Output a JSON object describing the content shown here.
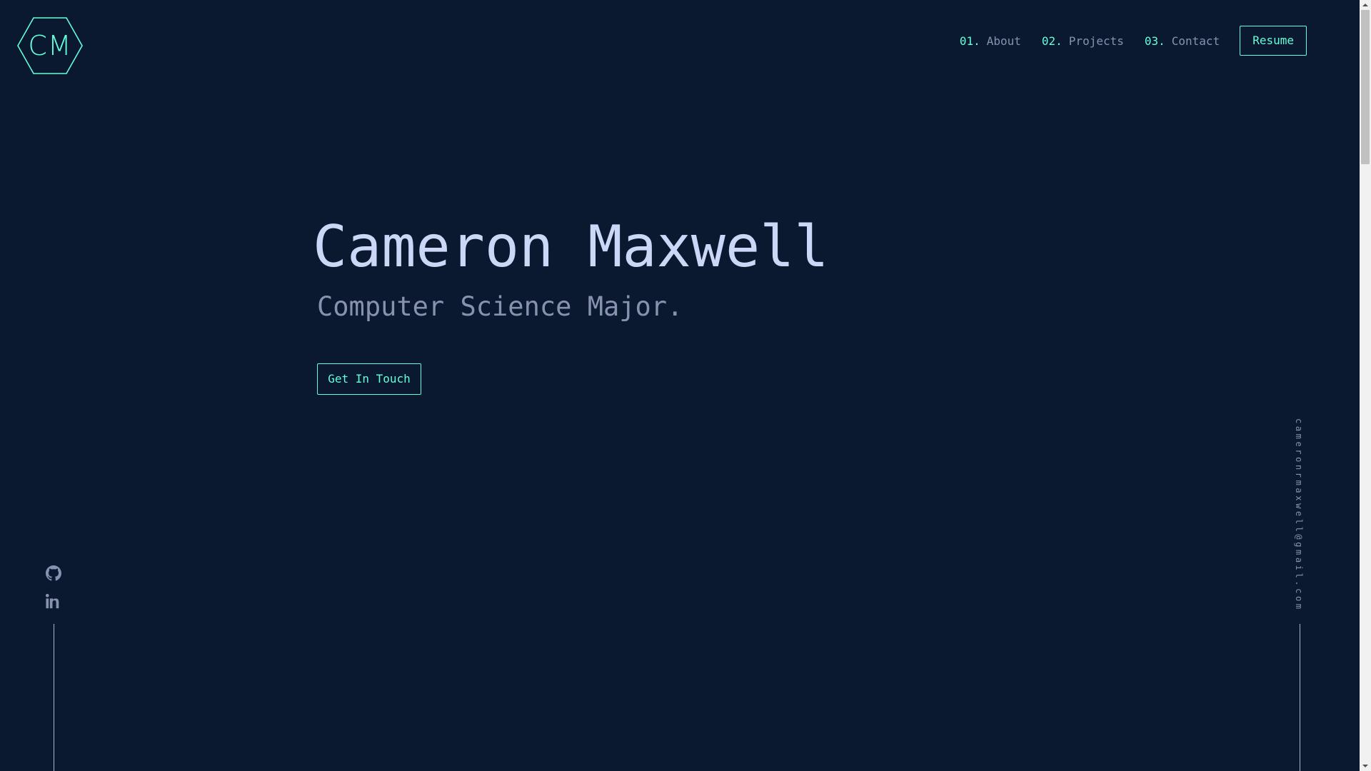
{
  "logo": {
    "text": "CM",
    "icon": "hexagon-logo-icon"
  },
  "nav": {
    "items": [
      {
        "num": "01.",
        "label": "About"
      },
      {
        "num": "02.",
        "label": "Projects"
      },
      {
        "num": "03.",
        "label": "Contact"
      }
    ],
    "resume_label": "Resume"
  },
  "hero": {
    "name": "Cameron Maxwell",
    "subtitle": "Computer Science Major.",
    "cta_label": "Get In Touch"
  },
  "social": [
    {
      "name": "github",
      "icon": "github-icon"
    },
    {
      "name": "linkedin",
      "icon": "linkedin-icon"
    }
  ],
  "email": "cameronrmaxwell@gmail.com",
  "colors": {
    "background": "#0a192f",
    "accent": "#64ffda",
    "heading": "#ccd6f6",
    "muted": "#8892b0"
  }
}
